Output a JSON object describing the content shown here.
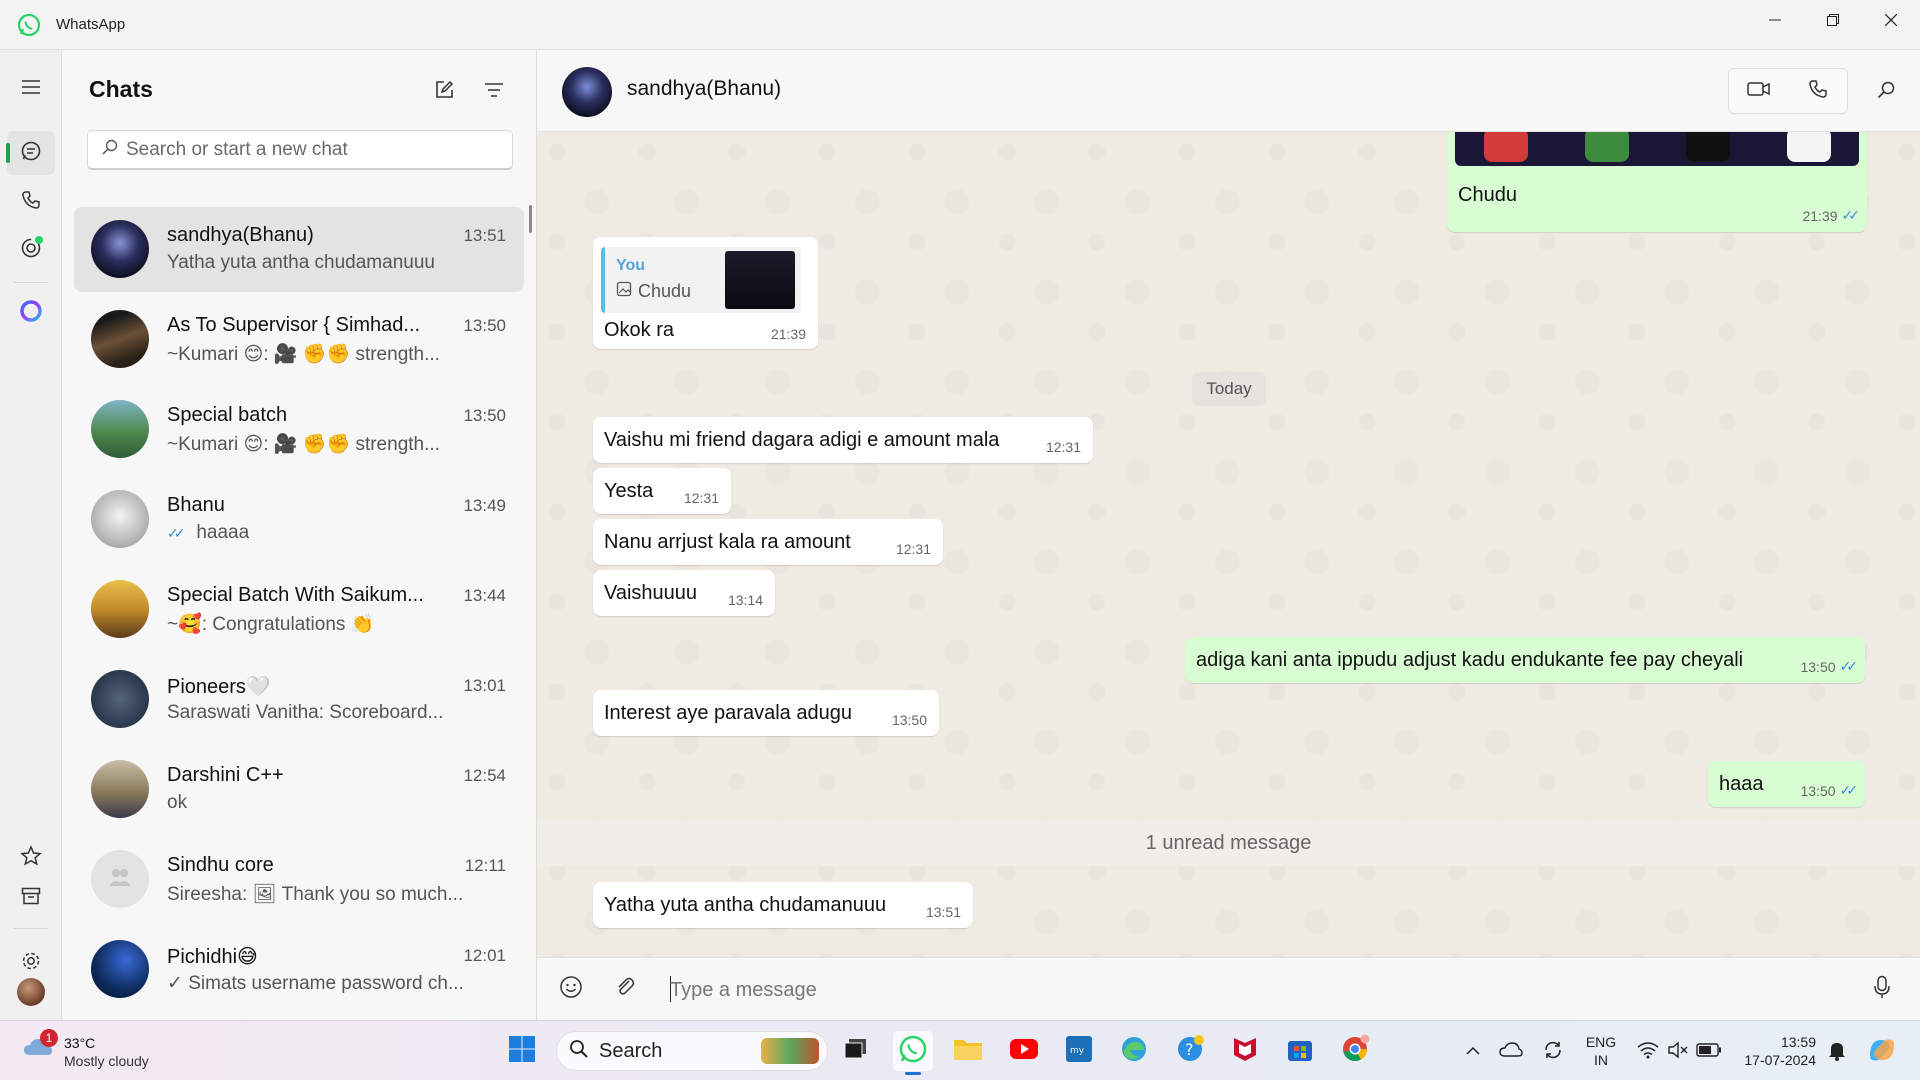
{
  "window": {
    "title": "WhatsApp",
    "controls": [
      "minimize",
      "restore",
      "close"
    ]
  },
  "sidebar": {
    "items": [
      {
        "name": "menu",
        "icon": "hamburger-icon"
      },
      {
        "name": "chats",
        "icon": "chat-icon",
        "active": true
      },
      {
        "name": "calls",
        "icon": "phone-icon"
      },
      {
        "name": "status",
        "icon": "status-icon",
        "has_update": true
      },
      {
        "name": "meta-ai",
        "icon": "meta-ai-icon"
      },
      {
        "name": "starred",
        "icon": "star-icon"
      },
      {
        "name": "archived",
        "icon": "archive-icon"
      },
      {
        "name": "settings",
        "icon": "gear-icon"
      },
      {
        "name": "profile",
        "icon": "avatar"
      }
    ]
  },
  "chats_panel": {
    "title": "Chats",
    "search_placeholder": "Search or start a new chat",
    "chats": [
      {
        "name": "sandhya(Bhanu)",
        "time": "13:51",
        "preview": "Yatha yuta antha chudamanuuu",
        "selected": true,
        "avatar_color": "#1c1f3a"
      },
      {
        "name": "As To Supervisor { Simhad...",
        "time": "13:50",
        "preview": "~Kumari 😊: 🎥 ✊✊ strength...",
        "avatar_color": "#4a3a2e"
      },
      {
        "name": "Special batch",
        "time": "13:50",
        "preview": "~Kumari 😊: 🎥 ✊✊ strength...",
        "avatar_color": "#3f7d5a"
      },
      {
        "name": "Bhanu",
        "time": "13:49",
        "preview": "haaaa",
        "read_ticks": true,
        "avatar_color": "#c9c9c9"
      },
      {
        "name": "Special Batch With Saikum...",
        "time": "13:44",
        "preview": "~🥰: Congratulations 👏",
        "avatar_color": "#c79a3a"
      },
      {
        "name": "Pioneers🤍",
        "time": "13:01",
        "preview": "Saraswati Vanitha: Scoreboard...",
        "avatar_color": "#2f3e52"
      },
      {
        "name": "Darshini C++",
        "time": "12:54",
        "preview": "ok",
        "avatar_color": "#8b7a5a"
      },
      {
        "name": "Sindhu core",
        "time": "12:11",
        "preview": "Sireesha: 🖼 Thank you so much...",
        "avatar_color": "#e3e3e3"
      },
      {
        "name": "Pichidhi😅",
        "time": "12:01",
        "preview": "✓ Simats username password ch...",
        "avatar_color": "#0c2a5a"
      }
    ]
  },
  "conversation": {
    "contact_name": "sandhya(Bhanu)",
    "composer_placeholder": "Type a message",
    "date_divider": "Today",
    "unread_divider": "1 unread message",
    "messages": [
      {
        "dir": "out",
        "text": "Chudu",
        "time": "21:39",
        "read": true,
        "has_image": true
      },
      {
        "dir": "in",
        "text": "Okok ra",
        "time": "21:39",
        "quote_author": "You",
        "quote_text": "Chudu"
      },
      {
        "dir": "in",
        "text": "Vaishu mi friend dagara adigi e amount mala",
        "time": "12:31"
      },
      {
        "dir": "in",
        "text": "Yesta",
        "time": "12:31"
      },
      {
        "dir": "in",
        "text": "Nanu arrjust kala ra amount",
        "time": "12:31"
      },
      {
        "dir": "in",
        "text": "Vaishuuuu",
        "time": "13:14"
      },
      {
        "dir": "out",
        "text": "adiga kani anta ippudu adjust kadu endukante fee pay cheyali",
        "time": "13:50",
        "read": true
      },
      {
        "dir": "in",
        "text": "Interest aye paravala adugu",
        "time": "13:50"
      },
      {
        "dir": "out",
        "text": "haaa",
        "time": "13:50",
        "read": true
      },
      {
        "dir": "in",
        "text": "Yatha yuta antha chudamanuuu",
        "time": "13:51"
      }
    ]
  },
  "taskbar": {
    "weather": {
      "temp": "33°C",
      "desc": "Mostly cloudy",
      "badge": "1"
    },
    "search_label": "Search",
    "apps": [
      "windows-start-icon",
      "search-icon",
      "task-view-icon",
      "whatsapp-icon",
      "file-explorer-icon",
      "youtube-icon",
      "mysql-icon",
      "edge-icon",
      "help-icon",
      "mcafee-icon",
      "store-icon",
      "chrome-icon"
    ],
    "lang": {
      "line1": "ENG",
      "line2": "IN"
    },
    "clock": {
      "time": "13:59",
      "date": "17-07-2024"
    }
  }
}
